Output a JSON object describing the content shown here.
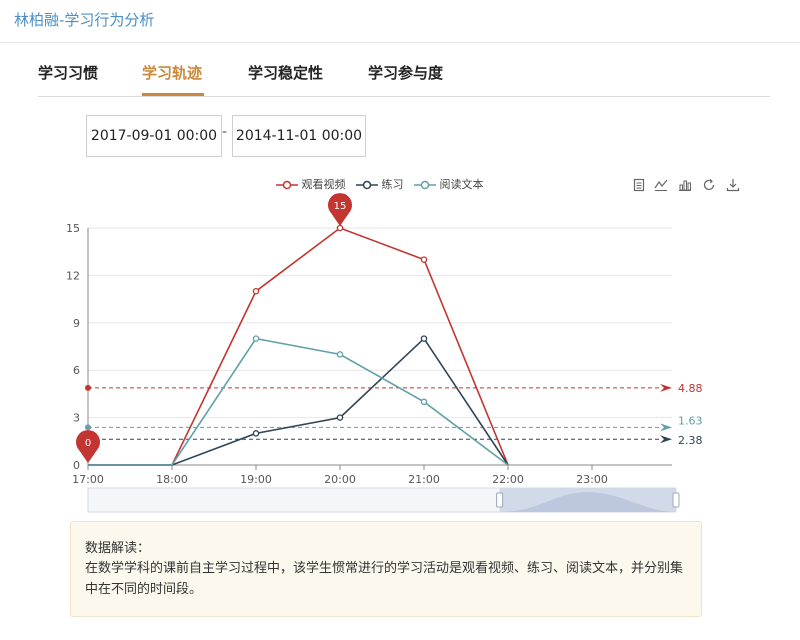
{
  "header": {
    "title": "林柏融-学习行为分析"
  },
  "tabs": [
    {
      "label": "学习习惯",
      "active": false
    },
    {
      "label": "学习轨迹",
      "active": true
    },
    {
      "label": "学习稳定性",
      "active": false
    },
    {
      "label": "学习参与度",
      "active": false
    }
  ],
  "date_range": {
    "start": "2017-09-01 00:00",
    "separator": "-",
    "end": "2014-11-01 00:00"
  },
  "toolbox": [
    "data-view-icon",
    "line-chart-icon",
    "bar-chart-icon",
    "restore-icon",
    "download-icon"
  ],
  "colors": {
    "accent": "#c9883a",
    "title": "#4a8fc7",
    "watch": "#c23531",
    "practice": "#2f4554",
    "read": "#61a0a8"
  },
  "chart_data": {
    "type": "line",
    "categories": [
      "17:00",
      "18:00",
      "19:00",
      "20:00",
      "21:00",
      "22:00",
      "23:00"
    ],
    "ylim": [
      0,
      15
    ],
    "yticks": [
      0,
      3,
      6,
      9,
      12,
      15
    ],
    "grid": true,
    "legend": "top-center",
    "series": [
      {
        "name": "观看视频",
        "values": [
          0,
          0,
          11,
          15,
          13,
          0,
          0
        ],
        "color": "#c23531",
        "average": 4.88,
        "max_label": "15",
        "min_label": "0"
      },
      {
        "name": "练习",
        "values": [
          0,
          0,
          2,
          3,
          8,
          0,
          0
        ],
        "color": "#2f4554",
        "average": 1.63
      },
      {
        "name": "阅读文本",
        "values": [
          0,
          0,
          8,
          7,
          4,
          0,
          0
        ],
        "color": "#61a0a8",
        "average": 2.38
      }
    ],
    "mark_lines": [
      "4.88",
      "2.38",
      "1.63"
    ],
    "data_zoom": {
      "start_fraction": 0.7,
      "end_fraction": 1.0
    }
  },
  "note": {
    "title": "数据解读：",
    "body": "在数学学科的课前自主学习过程中，该学生惯常进行的学习活动是观看视频、练习、阅读文本，并分别集中在不同的时间段。"
  }
}
